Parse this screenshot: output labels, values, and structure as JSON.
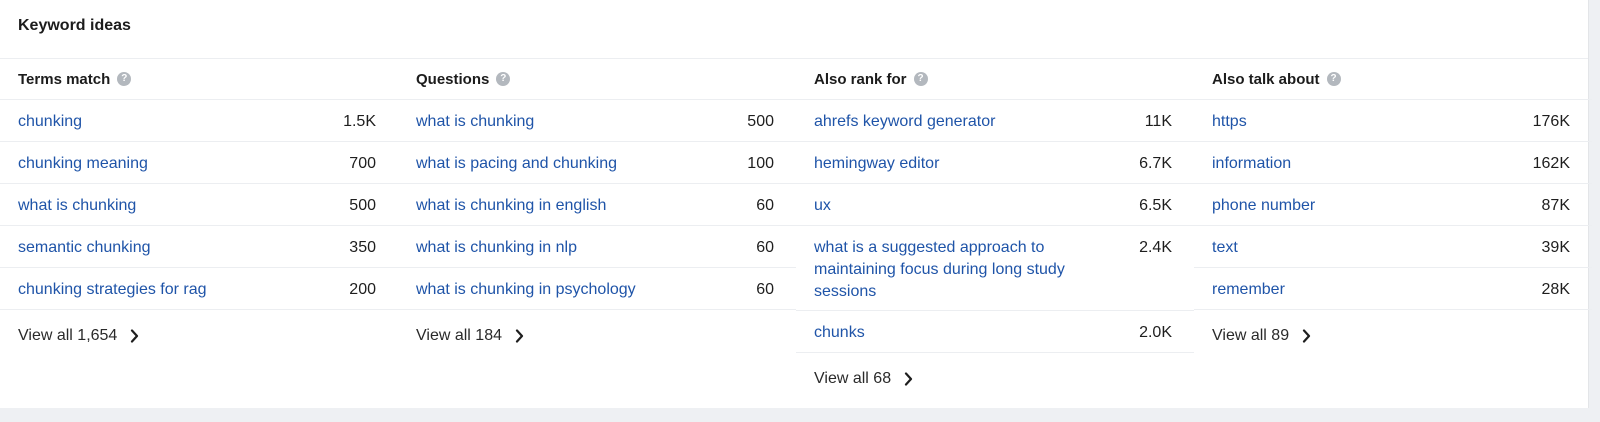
{
  "card": {
    "title": "Keyword ideas"
  },
  "columns": [
    {
      "title": "Terms match",
      "rows": [
        {
          "keyword": "chunking",
          "volume": "1.5K"
        },
        {
          "keyword": "chunking meaning",
          "volume": "700"
        },
        {
          "keyword": "what is chunking",
          "volume": "500"
        },
        {
          "keyword": "semantic chunking",
          "volume": "350"
        },
        {
          "keyword": "chunking strategies for rag",
          "volume": "200"
        }
      ],
      "view_all": "View all 1,654"
    },
    {
      "title": "Questions",
      "rows": [
        {
          "keyword": "what is chunking",
          "volume": "500"
        },
        {
          "keyword": "what is pacing and chunking",
          "volume": "100"
        },
        {
          "keyword": "what is chunking in english",
          "volume": "60"
        },
        {
          "keyword": "what is chunking in nlp",
          "volume": "60"
        },
        {
          "keyword": "what is chunking in psychology",
          "volume": "60"
        }
      ],
      "view_all": "View all 184"
    },
    {
      "title": "Also rank for",
      "rows": [
        {
          "keyword": "ahrefs keyword generator",
          "volume": "11K"
        },
        {
          "keyword": "hemingway editor",
          "volume": "6.7K"
        },
        {
          "keyword": "ux",
          "volume": "6.5K"
        },
        {
          "keyword": "what is a suggested approach to maintaining focus during long study sessions",
          "volume": "2.4K"
        },
        {
          "keyword": "chunks",
          "volume": "2.0K"
        }
      ],
      "view_all": "View all 68"
    },
    {
      "title": "Also talk about",
      "rows": [
        {
          "keyword": "https",
          "volume": "176K"
        },
        {
          "keyword": "information",
          "volume": "162K"
        },
        {
          "keyword": "phone number",
          "volume": "87K"
        },
        {
          "keyword": "text",
          "volume": "39K"
        },
        {
          "keyword": "remember",
          "volume": "28K"
        }
      ],
      "view_all": "View all 89"
    }
  ],
  "icons": {
    "help": "question-circle-icon",
    "chevron": "chevron-right-icon"
  },
  "colors": {
    "link": "#1f54a8",
    "help_icon": "#b3b8be",
    "background": "#eef0f3"
  }
}
